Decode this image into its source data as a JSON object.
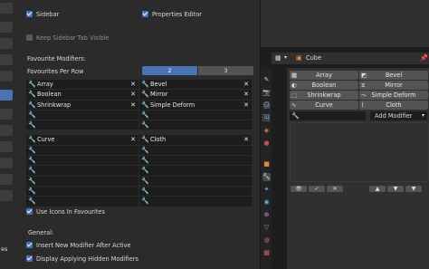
{
  "left_strip": {
    "text": "es"
  },
  "panel": {
    "sidebar_label": "Sidebar",
    "keep_sidebar_label": "Keep Sidebar Tab Visible",
    "properties_editor_label": "Properties Editor",
    "favourite_modifiers_heading": "Favourite Modifiers:",
    "favourites_per_row_label": "Favourites Per Row",
    "per_row_options": [
      "2",
      "3"
    ],
    "per_row_selected": "2",
    "favourites_left": [
      "Array",
      "Boolean",
      "Shrinkwrap",
      "",
      "",
      "Curve",
      "",
      "",
      "",
      "",
      "",
      ""
    ],
    "favourites_right": [
      "Bevel",
      "Mirror",
      "Simple Deform",
      "",
      "",
      "Cloth",
      "",
      "",
      "",
      "",
      "",
      ""
    ],
    "use_icons_label": "Use Icons In Favourites",
    "general_heading": "General:",
    "insert_after_active_label": "Insert New Modifier After Active",
    "display_applying_label": "Display Applying Hidden Modifiers"
  },
  "properties": {
    "object_name": "Cube",
    "modifier_grid": [
      {
        "label": "Array",
        "icon": "array-icon"
      },
      {
        "label": "Bevel",
        "icon": "bevel-icon"
      },
      {
        "label": "Boolean",
        "icon": "boolean-icon"
      },
      {
        "label": "Mirror",
        "icon": "mirror-icon"
      },
      {
        "label": "Shrinkwrap",
        "icon": "shrinkwrap-icon"
      },
      {
        "label": "Simple Deform",
        "icon": "simple-deform-icon"
      },
      {
        "label": "Curve",
        "icon": "curve-icon"
      },
      {
        "label": "Cloth",
        "icon": "cloth-icon"
      }
    ],
    "add_modifier_label": "Add Modifier"
  },
  "colors": {
    "accent": "#4772b3",
    "panel_bg": "#2b2b2b",
    "field_bg": "#1d1d1d",
    "button_bg": "#545454"
  }
}
